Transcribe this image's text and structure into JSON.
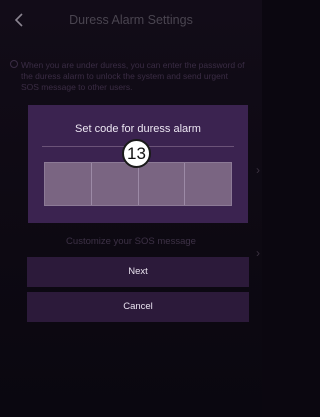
{
  "header": {
    "title": "Duress Alarm Settings",
    "back_icon": "chevron-left-icon"
  },
  "background": {
    "info_text": "When you are under duress, you can enter the password of the duress alarm to unlock the system and send urgent SOS message to other users.",
    "sos_label": "Customize your SOS message"
  },
  "dialog": {
    "title": "Set code for duress alarm",
    "code_cells": [
      "",
      "",
      "",
      ""
    ]
  },
  "badge": {
    "number": "13"
  },
  "buttons": {
    "next_label": "Next",
    "cancel_label": "Cancel"
  },
  "colors": {
    "dialog_bg": "#3b2350",
    "button_bg": "#2c1a3a",
    "code_cell_bg": "#7a6582"
  }
}
